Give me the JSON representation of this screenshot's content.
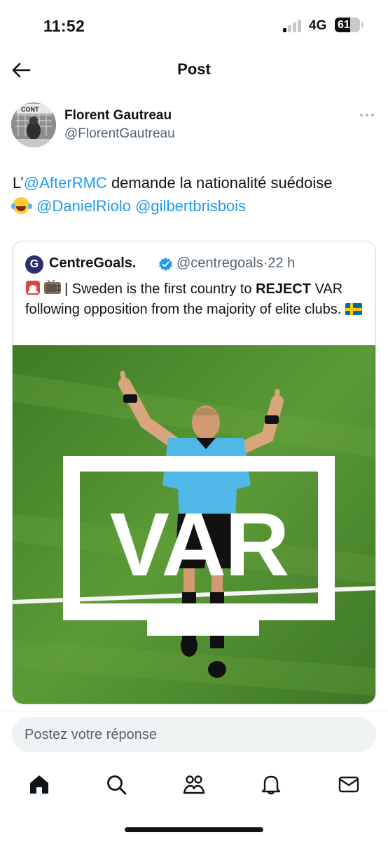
{
  "status_bar": {
    "time": "11:52",
    "network": "4G",
    "battery": "61",
    "battery_level": 0.61
  },
  "header": {
    "title": "Post",
    "back_icon": "arrow-left-icon"
  },
  "post": {
    "author_name": "Florent Gautreau",
    "author_handle": "@FlorentGautreau",
    "avatar_text": "CONT",
    "text_prefix": "L’",
    "mention_1": "@AfterRMC",
    "text_middle": " demande la nationalité suédoise",
    "mention_2": "@DanielRiolo",
    "mention_3": "@gilbertbrisbois"
  },
  "quote": {
    "avatar_letter": "G",
    "name": "CentreGoals.",
    "handle": "@centregoals",
    "separator": "·",
    "time": "22 h",
    "text_before": "| Sweden is the first country to ",
    "text_bold": "REJECT",
    "text_after": " VAR following opposition from the majority of elite clubs.",
    "image_text": "VAR",
    "colors": {
      "verified": "#1d9bf0",
      "referee_shirt": "#4fb8e6",
      "pitch": "#4f8f2f"
    }
  },
  "reply": {
    "placeholder": "Postez votre réponse"
  },
  "tabs": [
    {
      "icon": "home-icon"
    },
    {
      "icon": "search-icon"
    },
    {
      "icon": "communities-icon"
    },
    {
      "icon": "notifications-icon"
    },
    {
      "icon": "messages-icon"
    }
  ]
}
